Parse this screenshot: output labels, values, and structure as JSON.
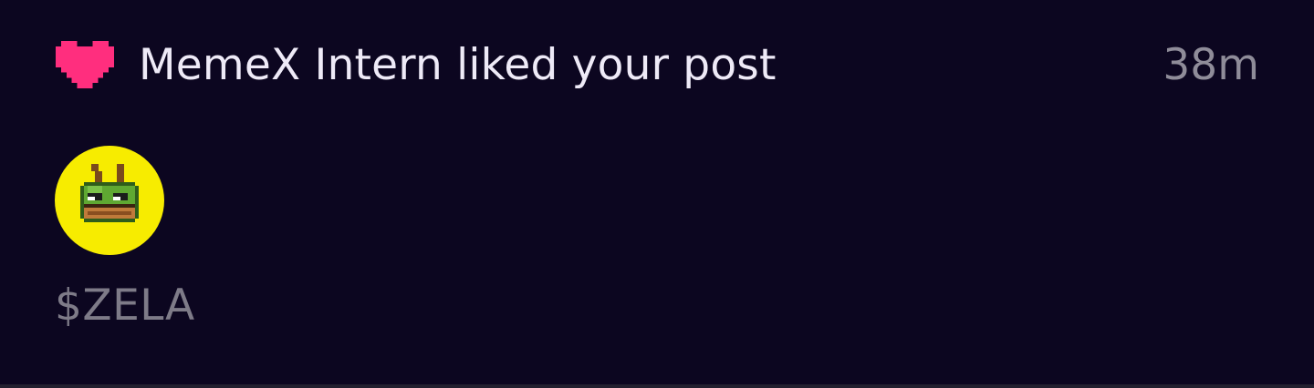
{
  "notification": {
    "icon": "heart-icon",
    "icon_color": "#ff2e7e",
    "message": "MemeX Intern liked your post",
    "time_ago": "38m",
    "token": {
      "avatar_icon": "pixel-frog-icon",
      "avatar_background": "#f7ec00",
      "ticker": "$ZELA"
    }
  }
}
